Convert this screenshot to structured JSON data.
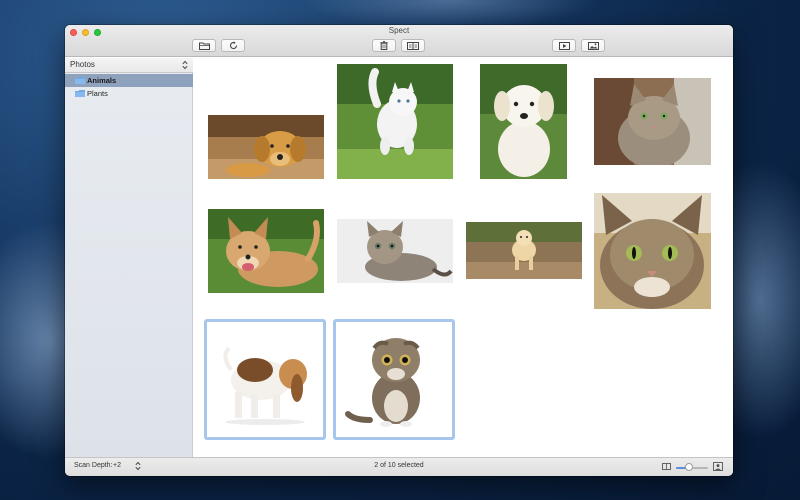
{
  "window": {
    "title": "Spect"
  },
  "toolbar": {
    "buttons": [
      {
        "icon": "folder-icon"
      },
      {
        "icon": "refresh-icon"
      },
      {
        "icon": "trash-icon"
      },
      {
        "icon": "compare-icon"
      },
      {
        "icon": "play-icon"
      },
      {
        "icon": "image-view-icon"
      }
    ]
  },
  "sidebar": {
    "selector_label": "Photos",
    "items": [
      {
        "label": "Animals",
        "selected": true
      },
      {
        "label": "Plants",
        "selected": false
      }
    ]
  },
  "gallery": {
    "total": 10,
    "selected_count": 2,
    "photos": [
      {
        "subject": "golden retriever puppy lying on floor",
        "selected": false
      },
      {
        "subject": "white kitten running in grass",
        "selected": false
      },
      {
        "subject": "white labrador puppy",
        "selected": false
      },
      {
        "subject": "tabby cat",
        "selected": false
      },
      {
        "subject": "happy dog lying in grass",
        "selected": false
      },
      {
        "subject": "tabby kitten lying down",
        "selected": false
      },
      {
        "subject": "puppy walking on path",
        "selected": false
      },
      {
        "subject": "tabby cat close-up face",
        "selected": false
      },
      {
        "subject": "beagle puppy",
        "selected": true
      },
      {
        "subject": "scottish fold cat sitting",
        "selected": true
      }
    ]
  },
  "statusbar": {
    "scan_depth_label": "Scan Depth:",
    "scan_depth_value": "+2",
    "status_text": "2 of 10 selected",
    "zoom_level": 0.4
  },
  "colors": {
    "accent": "#5b8fdc",
    "selection_border": "#a6c6ec",
    "sidebar_selected": "#8ea2be"
  }
}
